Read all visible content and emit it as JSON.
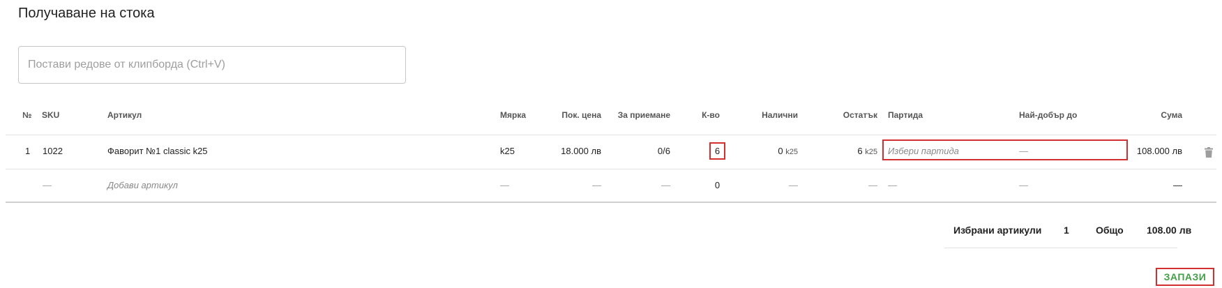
{
  "page": {
    "title": "Получаване на стока"
  },
  "paste": {
    "placeholder": "Постави редове от клипборда (Ctrl+V)"
  },
  "table": {
    "headers": {
      "num": "№",
      "sku": "SKU",
      "article": "Артикул",
      "unit": "Мярка",
      "price": "Пок. цена",
      "to_receive": "За приемане",
      "qty": "К-во",
      "available": "Налични",
      "remaining": "Остатък",
      "batch": "Партида",
      "best_before": "Най-добър до",
      "sum": "Сума"
    },
    "rows": [
      {
        "num": "1",
        "sku": "1022",
        "article": "Фаворит №1 classic k25",
        "unit": "k25",
        "price": "18.000 лв",
        "to_receive": "0/6",
        "qty": "6",
        "available_value": "0",
        "available_unit": "k25",
        "remaining_value": "6",
        "remaining_unit": "k25",
        "batch_placeholder": "Избери партида",
        "best_before": "—",
        "sum": "108.000 лв"
      }
    ],
    "add_row": {
      "sku": "—",
      "article_placeholder": "Добави артикул",
      "unit": "—",
      "price": "—",
      "to_receive": "—",
      "qty": "0",
      "available": "—",
      "remaining": "—",
      "batch": "—",
      "best_before": "—",
      "sum": "—"
    }
  },
  "summary": {
    "selected_label": "Избрани артикули",
    "selected_count": "1",
    "total_label": "Общо",
    "total_value": "108.00 лв"
  },
  "actions": {
    "save_label": "ЗАПАЗИ"
  },
  "colors": {
    "accent_green": "#43a047",
    "highlight_red": "#d32f2f"
  },
  "icons": {
    "delete": "trash-icon"
  }
}
